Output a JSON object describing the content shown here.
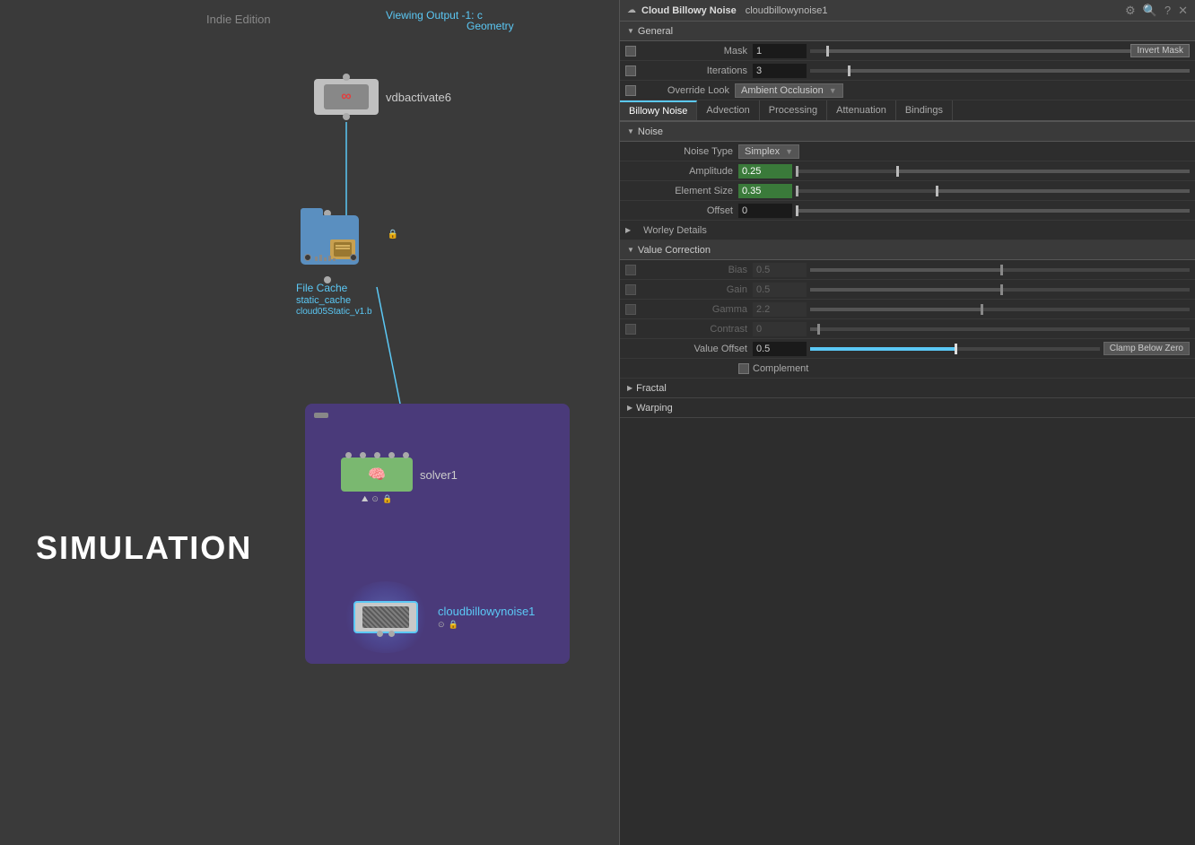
{
  "node_graph": {
    "indie_edition": "Indie Edition",
    "viewing_output": "Viewing Output -1: c",
    "geometry": "Geometry",
    "vdb_node_label": "vdbactivate6",
    "filecache_name": "File Cache",
    "filecache_subname": "static_cache",
    "filecache_path": "cloud05Static_v1.b",
    "solver_label": "solver1",
    "cloud_label": "cloudbillowynoise1",
    "simulation_text": "SIMULATION"
  },
  "panel": {
    "title": "Cloud Billowy Noise",
    "node_name": "cloudbillowynoise1",
    "icons": {
      "settings": "⚙",
      "search": "🔍",
      "question": "?",
      "close": "✕"
    },
    "general_section": {
      "label": "General",
      "mask_label": "Mask",
      "mask_value": "1",
      "invert_mask_label": "Invert Mask",
      "iterations_label": "Iterations",
      "iterations_value": "3",
      "override_look_label": "Override Look",
      "ambient_occlusion": "Ambient Occlusion"
    },
    "tabs": [
      {
        "label": "Billowy Noise",
        "active": true
      },
      {
        "label": "Advection",
        "active": false
      },
      {
        "label": "Processing",
        "active": false
      },
      {
        "label": "Attenuation",
        "active": false
      },
      {
        "label": "Bindings",
        "active": false
      }
    ],
    "noise_section": {
      "label": "Noise",
      "noise_type_label": "Noise Type",
      "noise_type_value": "Simplex",
      "amplitude_label": "Amplitude",
      "amplitude_value": "0.25",
      "element_size_label": "Element Size",
      "element_size_value": "0.35",
      "offset_label": "Offset",
      "offset_value": "0"
    },
    "worley_details": {
      "label": "Worley Details"
    },
    "value_correction": {
      "label": "Value Correction",
      "bias_label": "Bias",
      "bias_value": "0.5",
      "gain_label": "Gain",
      "gain_value": "0.5",
      "gamma_label": "Gamma",
      "gamma_value": "2.2",
      "contrast_label": "Contrast",
      "contrast_value": "0",
      "value_offset_label": "Value Offset",
      "value_offset_value": "0.5",
      "clamp_below_zero": "Clamp Below Zero",
      "complement_label": "Complement"
    },
    "fractal": {
      "label": "Fractal"
    },
    "warping": {
      "label": "Warping"
    }
  }
}
